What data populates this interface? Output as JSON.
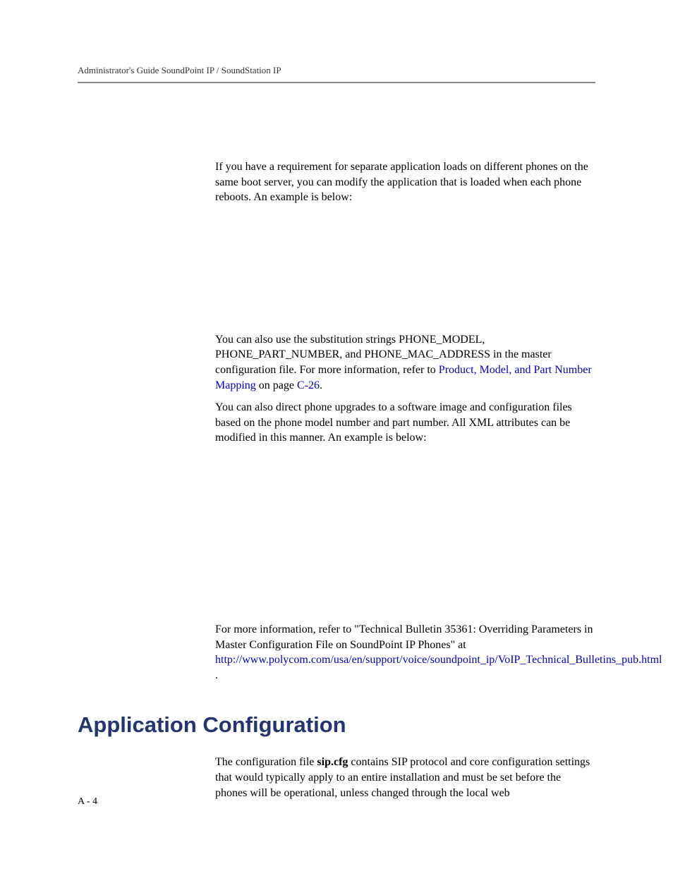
{
  "header": {
    "title": "Administrator's Guide SoundPoint IP / SoundStation IP"
  },
  "body": {
    "para1": "If you have a requirement for separate application loads on different phones on the same boot server, you can modify the application that is loaded when each phone reboots. An example is below:",
    "para2_pre": "You can also use the substitution strings PHONE_MODEL, PHONE_PART_NUMBER, and PHONE_MAC_ADDRESS in the master configuration file. For more information, refer to ",
    "para2_link": "Product, Model, and Part Number Mapping",
    "para2_mid": " on page ",
    "para2_pageref": "C-26",
    "para2_post": ".",
    "para3": "You can also direct phone upgrades to a software image and configuration files based on the phone model number and part number. All XML attributes can be modified in this manner. An example is below:",
    "para4_pre": "For more information, refer to \"Technical Bulletin 35361: Overriding Parameters in Master Configuration File on SoundPoint IP Phones\" at ",
    "para4_link": "http://www.polycom.com/usa/en/support/voice/soundpoint_ip/VoIP_Technical_Bulletins_pub.html",
    "para4_post": " ."
  },
  "section": {
    "heading": "Application Configuration",
    "para1_pre": "The configuration file ",
    "para1_bold": "sip.cfg",
    "para1_post": " contains SIP protocol and core configuration settings that would typically apply to an entire installation and must be set before the phones will be operational, unless changed through the local web"
  },
  "footer": {
    "pagenum": "A - 4"
  }
}
